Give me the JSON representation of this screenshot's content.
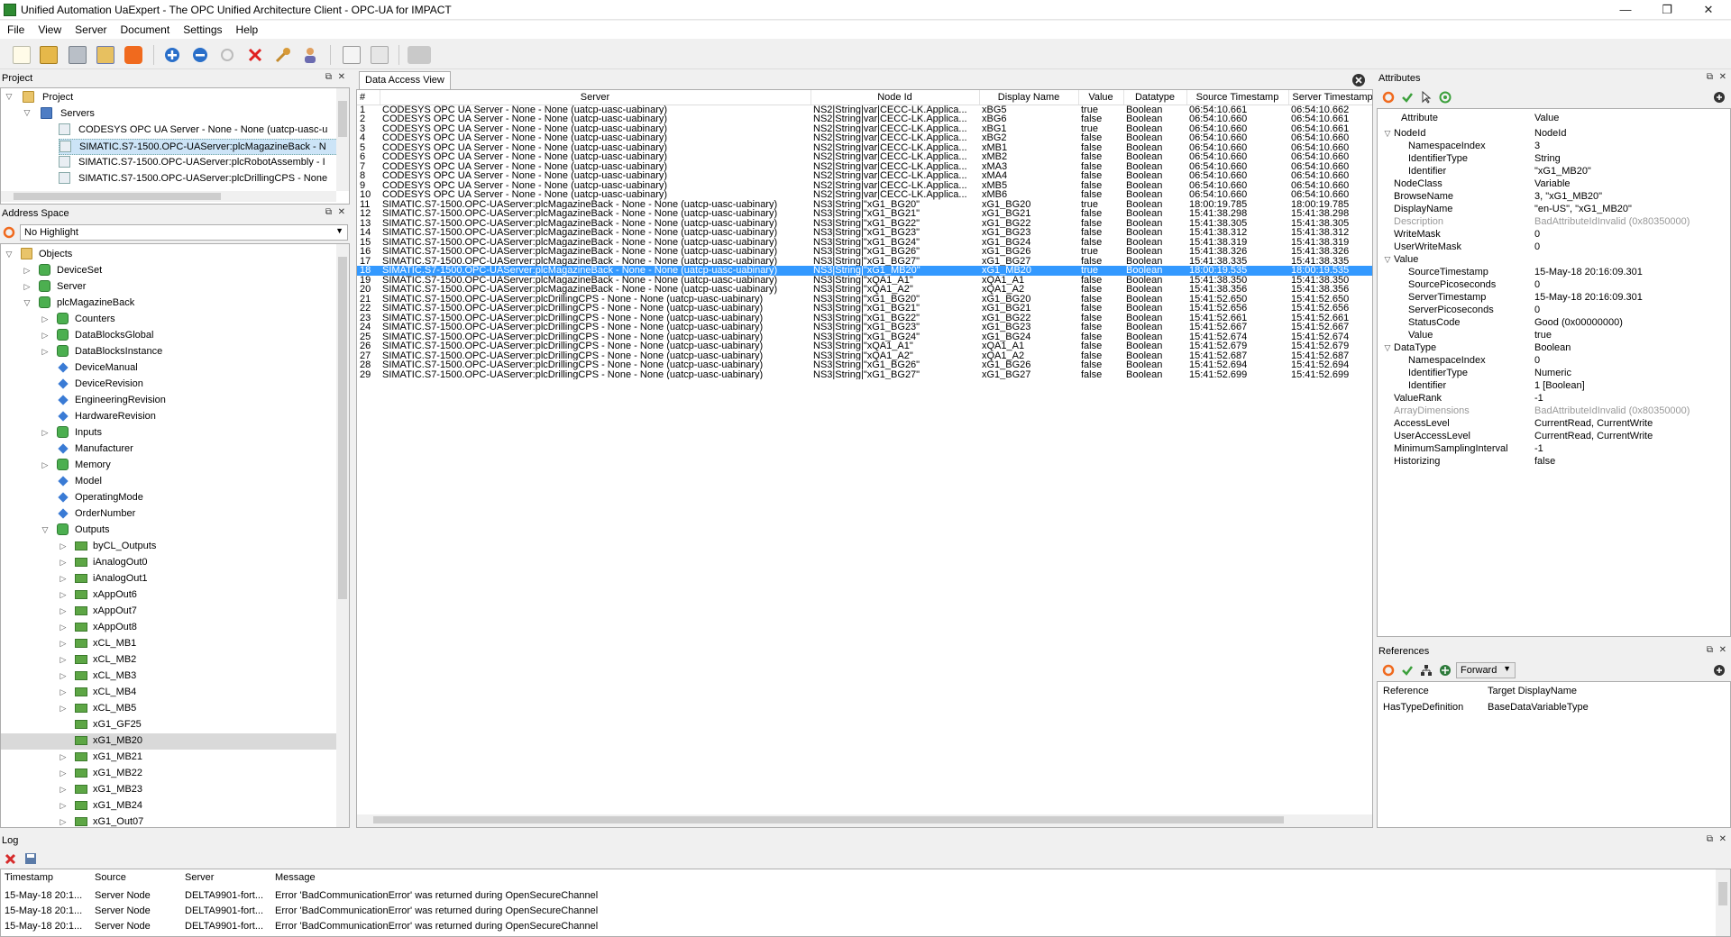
{
  "window": {
    "title": "Unified Automation UaExpert - The OPC Unified Architecture Client - OPC-UA for IMPACT",
    "minimize": "—",
    "maximize": "❐",
    "close": "✕"
  },
  "menu": [
    "File",
    "View",
    "Server",
    "Document",
    "Settings",
    "Help"
  ],
  "toolbar_icons": [
    "new-document-icon",
    "open-folder-icon",
    "save-icon",
    "save-as-icon",
    "power-icon",
    "add-server-icon",
    "remove-server-icon",
    "connect-icon",
    "disconnect-icon",
    "settings-wrench-icon",
    "user-icon",
    "report-icon",
    "clear-icon",
    "cable-icon"
  ],
  "project": {
    "title": "Project",
    "tree": {
      "root": "Project",
      "servers": "Servers",
      "items": [
        "CODESYS OPC UA Server - None - None (uatcp-uasc-u",
        "SIMATIC.S7-1500.OPC-UAServer:plcMagazineBack - N",
        "SIMATIC.S7-1500.OPC-UAServer:plcRobotAssembly - I",
        "SIMATIC.S7-1500.OPC-UAServer:plcDrillingCPS - None"
      ]
    }
  },
  "address_space": {
    "title": "Address Space",
    "highlight": "No Highlight",
    "nodes": [
      {
        "label": "Objects",
        "indent": 0,
        "icon": "folder",
        "arrow": "▽"
      },
      {
        "label": "DeviceSet",
        "indent": 1,
        "icon": "obj",
        "arrow": "▷"
      },
      {
        "label": "Server",
        "indent": 1,
        "icon": "obj",
        "arrow": "▷"
      },
      {
        "label": "plcMagazineBack",
        "indent": 1,
        "icon": "obj",
        "arrow": "▽"
      },
      {
        "label": "Counters",
        "indent": 2,
        "icon": "obj",
        "arrow": "▷"
      },
      {
        "label": "DataBlocksGlobal",
        "indent": 2,
        "icon": "obj",
        "arrow": "▷"
      },
      {
        "label": "DataBlocksInstance",
        "indent": 2,
        "icon": "obj",
        "arrow": "▷"
      },
      {
        "label": "DeviceManual",
        "indent": 2,
        "icon": "prop",
        "arrow": ""
      },
      {
        "label": "DeviceRevision",
        "indent": 2,
        "icon": "prop",
        "arrow": ""
      },
      {
        "label": "EngineeringRevision",
        "indent": 2,
        "icon": "prop",
        "arrow": ""
      },
      {
        "label": "HardwareRevision",
        "indent": 2,
        "icon": "prop",
        "arrow": ""
      },
      {
        "label": "Inputs",
        "indent": 2,
        "icon": "obj",
        "arrow": "▷"
      },
      {
        "label": "Manufacturer",
        "indent": 2,
        "icon": "prop",
        "arrow": ""
      },
      {
        "label": "Memory",
        "indent": 2,
        "icon": "obj",
        "arrow": "▷"
      },
      {
        "label": "Model",
        "indent": 2,
        "icon": "prop",
        "arrow": ""
      },
      {
        "label": "OperatingMode",
        "indent": 2,
        "icon": "prop",
        "arrow": ""
      },
      {
        "label": "OrderNumber",
        "indent": 2,
        "icon": "prop",
        "arrow": ""
      },
      {
        "label": "Outputs",
        "indent": 2,
        "icon": "obj",
        "arrow": "▽"
      },
      {
        "label": "byCL_Outputs",
        "indent": 3,
        "icon": "var",
        "arrow": "▷"
      },
      {
        "label": "iAnalogOut0",
        "indent": 3,
        "icon": "var",
        "arrow": "▷"
      },
      {
        "label": "iAnalogOut1",
        "indent": 3,
        "icon": "var",
        "arrow": "▷"
      },
      {
        "label": "xAppOut6",
        "indent": 3,
        "icon": "var",
        "arrow": "▷"
      },
      {
        "label": "xAppOut7",
        "indent": 3,
        "icon": "var",
        "arrow": "▷"
      },
      {
        "label": "xAppOut8",
        "indent": 3,
        "icon": "var",
        "arrow": "▷"
      },
      {
        "label": "xCL_MB1",
        "indent": 3,
        "icon": "var",
        "arrow": "▷"
      },
      {
        "label": "xCL_MB2",
        "indent": 3,
        "icon": "var",
        "arrow": "▷"
      },
      {
        "label": "xCL_MB3",
        "indent": 3,
        "icon": "var",
        "arrow": "▷"
      },
      {
        "label": "xCL_MB4",
        "indent": 3,
        "icon": "var",
        "arrow": "▷"
      },
      {
        "label": "xCL_MB5",
        "indent": 3,
        "icon": "var",
        "arrow": "▷"
      },
      {
        "label": "xG1_GF25",
        "indent": 3,
        "icon": "var",
        "arrow": ""
      },
      {
        "label": "xG1_MB20",
        "indent": 3,
        "icon": "var",
        "arrow": "",
        "selected": true
      },
      {
        "label": "xG1_MB21",
        "indent": 3,
        "icon": "var",
        "arrow": "▷"
      },
      {
        "label": "xG1_MB22",
        "indent": 3,
        "icon": "var",
        "arrow": "▷"
      },
      {
        "label": "xG1_MB23",
        "indent": 3,
        "icon": "var",
        "arrow": "▷"
      },
      {
        "label": "xG1_MB24",
        "indent": 3,
        "icon": "var",
        "arrow": "▷"
      },
      {
        "label": "xG1_Out07",
        "indent": 3,
        "icon": "var",
        "arrow": "▷"
      }
    ]
  },
  "dav": {
    "tab": "Data Access View",
    "headers": [
      "#",
      "Server",
      "Node Id",
      "Display Name",
      "Value",
      "Datatype",
      "Source Timestamp",
      "Server Timestamp"
    ],
    "rows": [
      [
        "1",
        "CODESYS OPC UA Server - None - None (uatcp-uasc-uabinary)",
        "NS2|String|var|CECC-LK.Applica...",
        "xBG5",
        "true",
        "Boolean",
        "06:54:10.661",
        "06:54:10.662"
      ],
      [
        "2",
        "CODESYS OPC UA Server - None - None (uatcp-uasc-uabinary)",
        "NS2|String|var|CECC-LK.Applica...",
        "xBG6",
        "false",
        "Boolean",
        "06:54:10.660",
        "06:54:10.661"
      ],
      [
        "3",
        "CODESYS OPC UA Server - None - None (uatcp-uasc-uabinary)",
        "NS2|String|var|CECC-LK.Applica...",
        "xBG1",
        "true",
        "Boolean",
        "06:54:10.660",
        "06:54:10.661"
      ],
      [
        "4",
        "CODESYS OPC UA Server - None - None (uatcp-uasc-uabinary)",
        "NS2|String|var|CECC-LK.Applica...",
        "xBG2",
        "false",
        "Boolean",
        "06:54:10.660",
        "06:54:10.660"
      ],
      [
        "5",
        "CODESYS OPC UA Server - None - None (uatcp-uasc-uabinary)",
        "NS2|String|var|CECC-LK.Applica...",
        "xMB1",
        "false",
        "Boolean",
        "06:54:10.660",
        "06:54:10.660"
      ],
      [
        "6",
        "CODESYS OPC UA Server - None - None (uatcp-uasc-uabinary)",
        "NS2|String|var|CECC-LK.Applica...",
        "xMB2",
        "false",
        "Boolean",
        "06:54:10.660",
        "06:54:10.660"
      ],
      [
        "7",
        "CODESYS OPC UA Server - None - None (uatcp-uasc-uabinary)",
        "NS2|String|var|CECC-LK.Applica...",
        "xMA3",
        "false",
        "Boolean",
        "06:54:10.660",
        "06:54:10.660"
      ],
      [
        "8",
        "CODESYS OPC UA Server - None - None (uatcp-uasc-uabinary)",
        "NS2|String|var|CECC-LK.Applica...",
        "xMA4",
        "false",
        "Boolean",
        "06:54:10.660",
        "06:54:10.660"
      ],
      [
        "9",
        "CODESYS OPC UA Server - None - None (uatcp-uasc-uabinary)",
        "NS2|String|var|CECC-LK.Applica...",
        "xMB5",
        "false",
        "Boolean",
        "06:54:10.660",
        "06:54:10.660"
      ],
      [
        "10",
        "CODESYS OPC UA Server - None - None (uatcp-uasc-uabinary)",
        "NS2|String|var|CECC-LK.Applica...",
        "xMB6",
        "false",
        "Boolean",
        "06:54:10.660",
        "06:54:10.660"
      ],
      [
        "11",
        "SIMATIC.S7-1500.OPC-UAServer:plcMagazineBack - None - None (uatcp-uasc-uabinary)",
        "NS3|String|\"xG1_BG20\"",
        "xG1_BG20",
        "true",
        "Boolean",
        "18:00:19.785",
        "18:00:19.785"
      ],
      [
        "12",
        "SIMATIC.S7-1500.OPC-UAServer:plcMagazineBack - None - None (uatcp-uasc-uabinary)",
        "NS3|String|\"xG1_BG21\"",
        "xG1_BG21",
        "false",
        "Boolean",
        "15:41:38.298",
        "15:41:38.298"
      ],
      [
        "13",
        "SIMATIC.S7-1500.OPC-UAServer:plcMagazineBack - None - None (uatcp-uasc-uabinary)",
        "NS3|String|\"xG1_BG22\"",
        "xG1_BG22",
        "false",
        "Boolean",
        "15:41:38.305",
        "15:41:38.305"
      ],
      [
        "14",
        "SIMATIC.S7-1500.OPC-UAServer:plcMagazineBack - None - None (uatcp-uasc-uabinary)",
        "NS3|String|\"xG1_BG23\"",
        "xG1_BG23",
        "false",
        "Boolean",
        "15:41:38.312",
        "15:41:38.312"
      ],
      [
        "15",
        "SIMATIC.S7-1500.OPC-UAServer:plcMagazineBack - None - None (uatcp-uasc-uabinary)",
        "NS3|String|\"xG1_BG24\"",
        "xG1_BG24",
        "false",
        "Boolean",
        "15:41:38.319",
        "15:41:38.319"
      ],
      [
        "16",
        "SIMATIC.S7-1500.OPC-UAServer:plcMagazineBack - None - None (uatcp-uasc-uabinary)",
        "NS3|String|\"xG1_BG26\"",
        "xG1_BG26",
        "true",
        "Boolean",
        "15:41:38.326",
        "15:41:38.326"
      ],
      [
        "17",
        "SIMATIC.S7-1500.OPC-UAServer:plcMagazineBack - None - None (uatcp-uasc-uabinary)",
        "NS3|String|\"xG1_BG27\"",
        "xG1_BG27",
        "false",
        "Boolean",
        "15:41:38.335",
        "15:41:38.335"
      ],
      [
        "18",
        "SIMATIC.S7-1500.OPC-UAServer:plcMagazineBack - None - None (uatcp-uasc-uabinary)",
        "NS3|String|\"xG1_MB20\"",
        "xG1_MB20",
        "true",
        "Boolean",
        "18:00:19.535",
        "18:00:19.535"
      ],
      [
        "19",
        "SIMATIC.S7-1500.OPC-UAServer:plcMagazineBack - None - None (uatcp-uasc-uabinary)",
        "NS3|String|\"xQA1_A1\"",
        "xQA1_A1",
        "false",
        "Boolean",
        "15:41:38.350",
        "15:41:38.350"
      ],
      [
        "20",
        "SIMATIC.S7-1500.OPC-UAServer:plcMagazineBack - None - None (uatcp-uasc-uabinary)",
        "NS3|String|\"xQA1_A2\"",
        "xQA1_A2",
        "false",
        "Boolean",
        "15:41:38.356",
        "15:41:38.356"
      ],
      [
        "21",
        "SIMATIC.S7-1500.OPC-UAServer:plcDrillingCPS - None - None (uatcp-uasc-uabinary)",
        "NS3|String|\"xG1_BG20\"",
        "xG1_BG20",
        "false",
        "Boolean",
        "15:41:52.650",
        "15:41:52.650"
      ],
      [
        "22",
        "SIMATIC.S7-1500.OPC-UAServer:plcDrillingCPS - None - None (uatcp-uasc-uabinary)",
        "NS3|String|\"xG1_BG21\"",
        "xG1_BG21",
        "false",
        "Boolean",
        "15:41:52.656",
        "15:41:52.656"
      ],
      [
        "23",
        "SIMATIC.S7-1500.OPC-UAServer:plcDrillingCPS - None - None (uatcp-uasc-uabinary)",
        "NS3|String|\"xG1_BG22\"",
        "xG1_BG22",
        "false",
        "Boolean",
        "15:41:52.661",
        "15:41:52.661"
      ],
      [
        "24",
        "SIMATIC.S7-1500.OPC-UAServer:plcDrillingCPS - None - None (uatcp-uasc-uabinary)",
        "NS3|String|\"xG1_BG23\"",
        "xG1_BG23",
        "false",
        "Boolean",
        "15:41:52.667",
        "15:41:52.667"
      ],
      [
        "25",
        "SIMATIC.S7-1500.OPC-UAServer:plcDrillingCPS - None - None (uatcp-uasc-uabinary)",
        "NS3|String|\"xG1_BG24\"",
        "xG1_BG24",
        "false",
        "Boolean",
        "15:41:52.674",
        "15:41:52.674"
      ],
      [
        "26",
        "SIMATIC.S7-1500.OPC-UAServer:plcDrillingCPS - None - None (uatcp-uasc-uabinary)",
        "NS3|String|\"xQA1_A1\"",
        "xQA1_A1",
        "false",
        "Boolean",
        "15:41:52.679",
        "15:41:52.679"
      ],
      [
        "27",
        "SIMATIC.S7-1500.OPC-UAServer:plcDrillingCPS - None - None (uatcp-uasc-uabinary)",
        "NS3|String|\"xQA1_A2\"",
        "xQA1_A2",
        "false",
        "Boolean",
        "15:41:52.687",
        "15:41:52.687"
      ],
      [
        "28",
        "SIMATIC.S7-1500.OPC-UAServer:plcDrillingCPS - None - None (uatcp-uasc-uabinary)",
        "NS3|String|\"xG1_BG26\"",
        "xG1_BG26",
        "false",
        "Boolean",
        "15:41:52.694",
        "15:41:52.694"
      ],
      [
        "29",
        "SIMATIC.S7-1500.OPC-UAServer:plcDrillingCPS - None - None (uatcp-uasc-uabinary)",
        "NS3|String|\"xG1_BG27\"",
        "xG1_BG27",
        "false",
        "Boolean",
        "15:41:52.699",
        "15:41:52.699"
      ]
    ],
    "selected_row": 18
  },
  "attributes": {
    "title": "Attributes",
    "col_attr": "Attribute",
    "col_value": "Value",
    "rows": [
      {
        "name": "NodeId",
        "value": "NodeId",
        "indent": 0,
        "arrow": "▽"
      },
      {
        "name": "NamespaceIndex",
        "value": "3",
        "indent": 1,
        "arrow": ""
      },
      {
        "name": "IdentifierType",
        "value": "String",
        "indent": 1,
        "arrow": ""
      },
      {
        "name": "Identifier",
        "value": "\"xG1_MB20\"",
        "indent": 1,
        "arrow": ""
      },
      {
        "name": "NodeClass",
        "value": "Variable",
        "indent": 0,
        "arrow": ""
      },
      {
        "name": "BrowseName",
        "value": "3, \"xG1_MB20\"",
        "indent": 0,
        "arrow": ""
      },
      {
        "name": "DisplayName",
        "value": "\"en-US\", \"xG1_MB20\"",
        "indent": 0,
        "arrow": ""
      },
      {
        "name": "Description",
        "value": "BadAttributeIdInvalid (0x80350000)",
        "indent": 0,
        "arrow": "",
        "gray": true
      },
      {
        "name": "WriteMask",
        "value": "0",
        "indent": 0,
        "arrow": ""
      },
      {
        "name": "UserWriteMask",
        "value": "0",
        "indent": 0,
        "arrow": ""
      },
      {
        "name": "Value",
        "value": "",
        "indent": 0,
        "arrow": "▽"
      },
      {
        "name": "SourceTimestamp",
        "value": "15-May-18 20:16:09.301",
        "indent": 1,
        "arrow": ""
      },
      {
        "name": "SourcePicoseconds",
        "value": "0",
        "indent": 1,
        "arrow": ""
      },
      {
        "name": "ServerTimestamp",
        "value": "15-May-18 20:16:09.301",
        "indent": 1,
        "arrow": ""
      },
      {
        "name": "ServerPicoseconds",
        "value": "0",
        "indent": 1,
        "arrow": ""
      },
      {
        "name": "StatusCode",
        "value": "Good (0x00000000)",
        "indent": 1,
        "arrow": ""
      },
      {
        "name": "Value",
        "value": "true",
        "indent": 1,
        "arrow": ""
      },
      {
        "name": "DataType",
        "value": "Boolean",
        "indent": 0,
        "arrow": "▽"
      },
      {
        "name": "NamespaceIndex",
        "value": "0",
        "indent": 1,
        "arrow": ""
      },
      {
        "name": "IdentifierType",
        "value": "Numeric",
        "indent": 1,
        "arrow": ""
      },
      {
        "name": "Identifier",
        "value": "1 [Boolean]",
        "indent": 1,
        "arrow": ""
      },
      {
        "name": "ValueRank",
        "value": "-1",
        "indent": 0,
        "arrow": ""
      },
      {
        "name": "ArrayDimensions",
        "value": "BadAttributeIdInvalid (0x80350000)",
        "indent": 0,
        "arrow": "",
        "gray": true
      },
      {
        "name": "AccessLevel",
        "value": "CurrentRead, CurrentWrite",
        "indent": 0,
        "arrow": ""
      },
      {
        "name": "UserAccessLevel",
        "value": "CurrentRead, CurrentWrite",
        "indent": 0,
        "arrow": ""
      },
      {
        "name": "MinimumSamplingInterval",
        "value": "-1",
        "indent": 0,
        "arrow": ""
      },
      {
        "name": "Historizing",
        "value": "false",
        "indent": 0,
        "arrow": ""
      }
    ]
  },
  "references": {
    "title": "References",
    "direction": "Forward",
    "col_ref": "Reference",
    "col_target": "Target DisplayName",
    "rows": [
      [
        "HasTypeDefinition",
        "BaseDataVariableType"
      ]
    ]
  },
  "log": {
    "title": "Log",
    "headers": [
      "Timestamp",
      "Source",
      "Server",
      "Message"
    ],
    "rows": [
      [
        "15-May-18 20:1...",
        "Server Node",
        "DELTA9901-fort...",
        "Error 'BadCommunicationError' was returned during OpenSecureChannel"
      ],
      [
        "15-May-18 20:1...",
        "Server Node",
        "DELTA9901-fort...",
        "Error 'BadCommunicationError' was returned during OpenSecureChannel"
      ],
      [
        "15-May-18 20:1...",
        "Server Node",
        "DELTA9901-fort...",
        "Error 'BadCommunicationError' was returned during OpenSecureChannel"
      ]
    ]
  },
  "colors": {
    "selection": "#3399ff",
    "tree_selection": "#d9d9d9",
    "accent_orange": "#f06a1e",
    "accent_blue": "#2a6fc9",
    "error_red": "#d62b2b"
  }
}
